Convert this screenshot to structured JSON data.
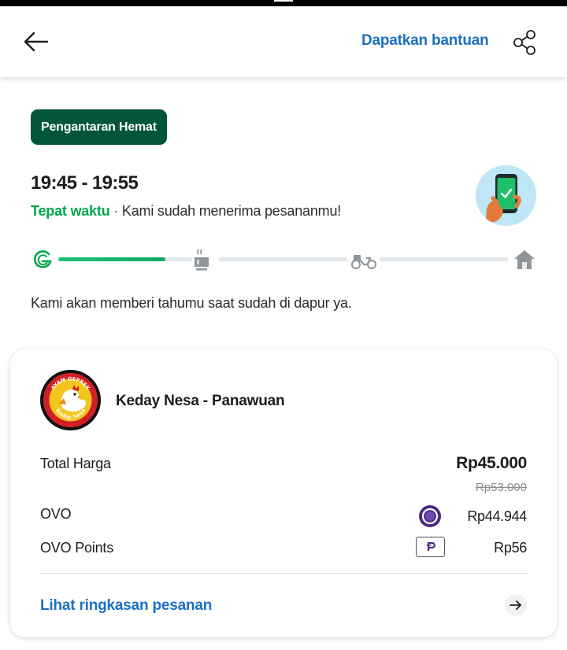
{
  "header": {
    "help_label": "Dapatkan bantuan"
  },
  "delivery": {
    "service_badge": "Pengantaran Hemat",
    "eta": "19:45 - 19:55",
    "status_highlight": "Tepat waktu",
    "status_separator": "·",
    "status_message": "Kami sudah menerima pesananmu!",
    "progress": {
      "steps": [
        "order-received",
        "cooking",
        "delivering",
        "arrived"
      ],
      "current_step_fraction": 0.8,
      "active_color": "#00a848"
    },
    "info_message": "Kami akan memberi tahumu saat sudah di dapur ya."
  },
  "order": {
    "restaurant_name": "Keday Nesa - Panawuan",
    "logo_text_top": "AYAM GEPREK",
    "logo_text_bottom": "Keday Nesa",
    "total_label": "Total Harga",
    "total_value": "Rp45.000",
    "original_value": "Rp53.000",
    "payments": [
      {
        "label": "OVO",
        "value": "Rp44.944",
        "icon": "ovo-icon"
      },
      {
        "label": "OVO Points",
        "value": "Rp56",
        "icon": "ovo-points-icon"
      }
    ],
    "summary_link": "Lihat ringkasan pesanan"
  },
  "colors": {
    "brand_green": "#00553a",
    "link_blue": "#1d6fc4",
    "success_green": "#00a848",
    "ovo_purple": "#4c2a86"
  }
}
